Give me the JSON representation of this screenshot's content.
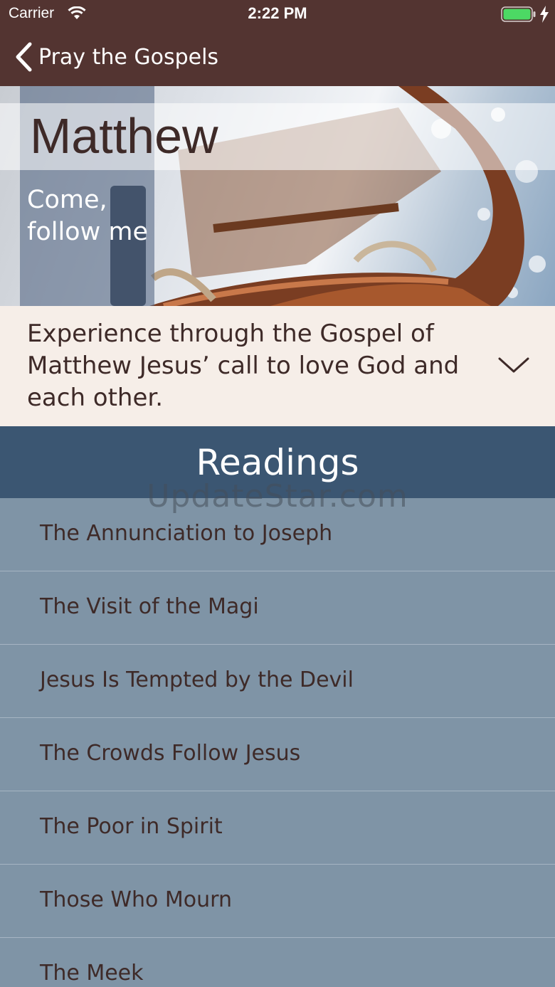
{
  "status_bar": {
    "carrier": "Carrier",
    "time": "2:22 PM",
    "battery_color": "#4cd964"
  },
  "nav": {
    "back_label": "Pray the Gospels",
    "bar_color": "#533431"
  },
  "hero": {
    "title": "Matthew",
    "subtitle_line1": "Come,",
    "subtitle_line2": "follow me"
  },
  "description": {
    "text": "Experience through the Gospel of Matthew Jesus’ call to love God and each other.",
    "expand_icon": "chevron-down-icon"
  },
  "readings": {
    "header": "Readings",
    "header_color": "#3b5672",
    "items": [
      {
        "label": "The Annunciation to Joseph"
      },
      {
        "label": "The Visit of the Magi"
      },
      {
        "label": "Jesus Is Tempted by the Devil"
      },
      {
        "label": "The Crowds Follow Jesus"
      },
      {
        "label": "The Poor in Spirit"
      },
      {
        "label": "Those Who Mourn"
      },
      {
        "label": "The Meek"
      }
    ]
  },
  "watermark": "UpdateStar.com"
}
